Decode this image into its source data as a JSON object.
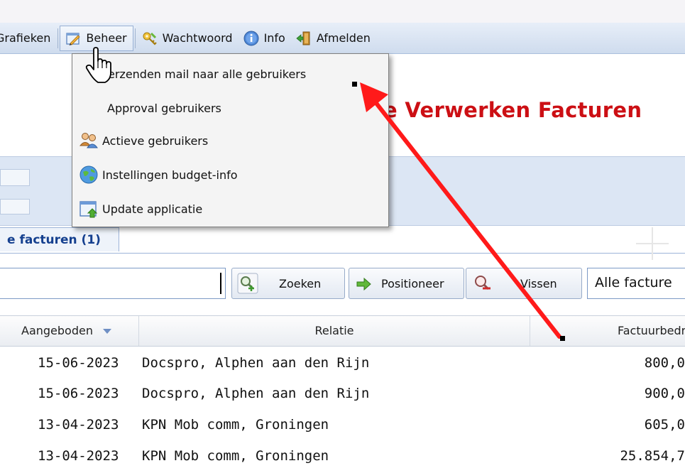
{
  "menubar": {
    "items": [
      {
        "label": "Grafieken",
        "icon": "none"
      },
      {
        "label": "Beheer",
        "icon": "pencil-edit-icon"
      },
      {
        "label": "Wachtwoord",
        "icon": "keys-icon"
      },
      {
        "label": "Info",
        "icon": "info-icon"
      },
      {
        "label": "Afmelden",
        "icon": "logout-door-icon"
      }
    ]
  },
  "dropdown": {
    "items": [
      {
        "label": "Verzenden mail naar alle gebruikers",
        "visible_label": "erzenden mail naar alle gebruikers",
        "icon": "none"
      },
      {
        "label": "Approval gebruikers",
        "icon": "none"
      },
      {
        "label": "Actieve gebruikers",
        "icon": "users-icon"
      },
      {
        "label": "Instellingen budget-info",
        "icon": "globe-icon"
      },
      {
        "label": "Update applicatie",
        "icon": "update-window-icon"
      }
    ]
  },
  "page": {
    "title_visible": "e Verwerken Facturen"
  },
  "tabs": {
    "active_label": "e facturen (1)"
  },
  "search": {
    "buttons": {
      "zoeken": "Zoeken",
      "positioneer": "Positioneer",
      "wissen": "Wissen",
      "wissen_visible": "Vissen"
    },
    "filter_value": "Alle facture"
  },
  "grid": {
    "columns": [
      "Aangeboden",
      "Relatie",
      "Factuurbedra"
    ],
    "rows": [
      {
        "date": "15-06-2023",
        "relatie": "Docspro, Alphen aan den Rijn",
        "bedrag": "800,0"
      },
      {
        "date": "15-06-2023",
        "relatie": "Docspro, Alphen aan den Rijn",
        "bedrag": "900,0"
      },
      {
        "date": "13-04-2023",
        "relatie": "KPN Mob comm, Groningen",
        "bedrag": "605,0"
      },
      {
        "date": "13-04-2023",
        "relatie": "KPN Mob comm, Groningen",
        "bedrag": "25.854,7"
      }
    ]
  },
  "colors": {
    "title_red": "#cc0f14",
    "annotation_arrow": "#ff1a1a",
    "tab_text": "#15408f"
  }
}
